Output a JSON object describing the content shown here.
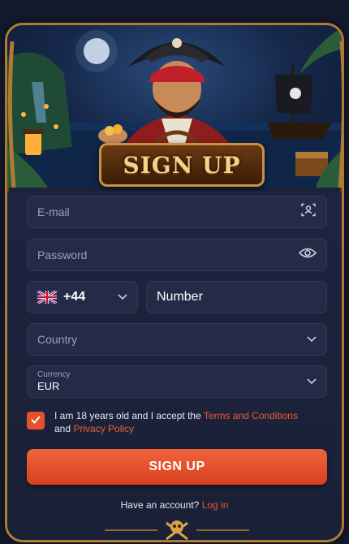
{
  "title": "SIGN UP",
  "form": {
    "email_placeholder": "E-mail",
    "password_placeholder": "Password",
    "phone_code": "+44",
    "number_placeholder": "Number",
    "country_placeholder": "Country",
    "currency_label": "Currency",
    "currency_value": "EUR",
    "agree_prefix": "I am 18 years old and I accept the ",
    "terms_link": "Terms and Conditions",
    "agree_and": "and ",
    "privacy_link": "Privacy Policy",
    "submit_label": "SIGN UP",
    "login_prompt": "Have an account? ",
    "login_link": "Log in"
  },
  "icons": {
    "email_field": "user-scan-icon",
    "password_field": "eye-icon",
    "phone_code": "uk-flag-icon",
    "dropdown": "chevron-down-icon",
    "checkbox": "checkmark-icon",
    "footer": "skull-crossbones-icon"
  },
  "colors": {
    "accent": "#ef5a34",
    "button": "#e4512b",
    "panel": "#1b2137",
    "field": "#232b47",
    "gold_border": "#b07a34"
  }
}
